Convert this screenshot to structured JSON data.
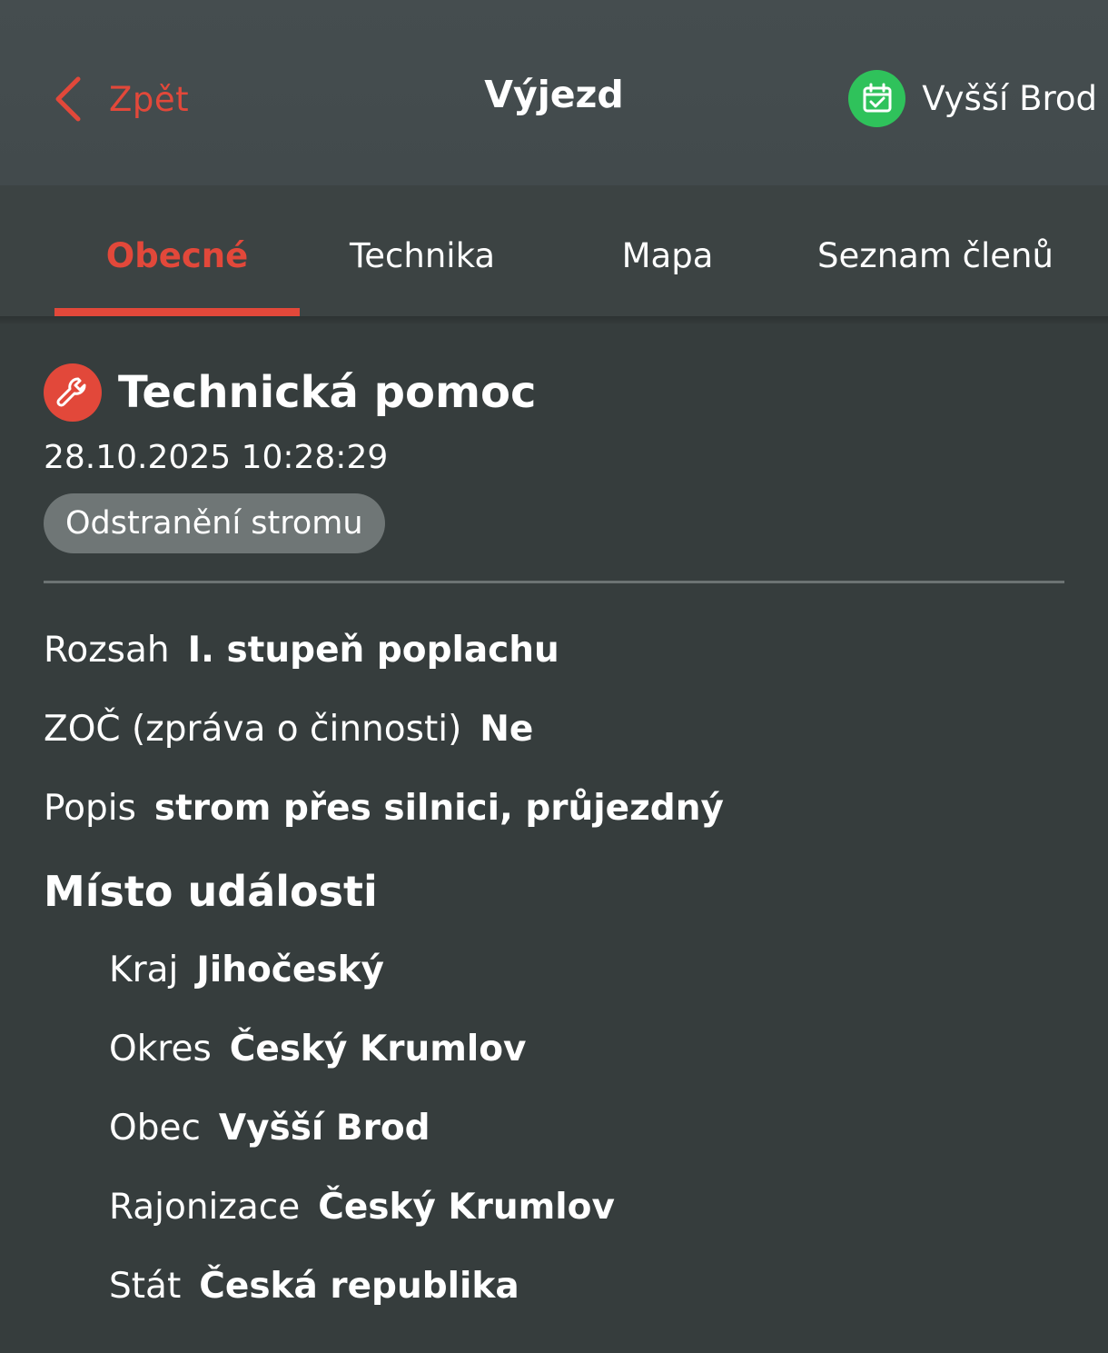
{
  "header": {
    "back_label": "Zpět",
    "title": "Výjezd",
    "unit_name": "Vyšší Brod",
    "unit_icon": "calendar-check-icon",
    "accent_color": "#e2483a",
    "unit_icon_color": "#2fc25b"
  },
  "tabs": [
    {
      "label": "Obecné",
      "active": true
    },
    {
      "label": "Technika",
      "active": false
    },
    {
      "label": "Mapa",
      "active": false
    },
    {
      "label": "Seznam členů",
      "active": false
    }
  ],
  "incident": {
    "icon": "wrench-icon",
    "title": "Technická pomoc",
    "timestamp": "28.10.2025 10:28:29",
    "type": "Odstranění stromu"
  },
  "details": [
    {
      "label": "Rozsah",
      "value": "I. stupeň poplachu"
    },
    {
      "label": "ZOČ (zpráva o činnosti)",
      "value": "Ne"
    },
    {
      "label": "Popis",
      "value": "strom přes silnici, průjezdný"
    }
  ],
  "location": {
    "title": "Místo události",
    "rows": [
      {
        "label": "Kraj",
        "value": "Jihočeský"
      },
      {
        "label": "Okres",
        "value": "Český Krumlov"
      },
      {
        "label": "Obec",
        "value": "Vyšší Brod"
      },
      {
        "label": "Rajonizace",
        "value": "Český Krumlov"
      },
      {
        "label": "Stát",
        "value": "Česká republika"
      }
    ]
  }
}
